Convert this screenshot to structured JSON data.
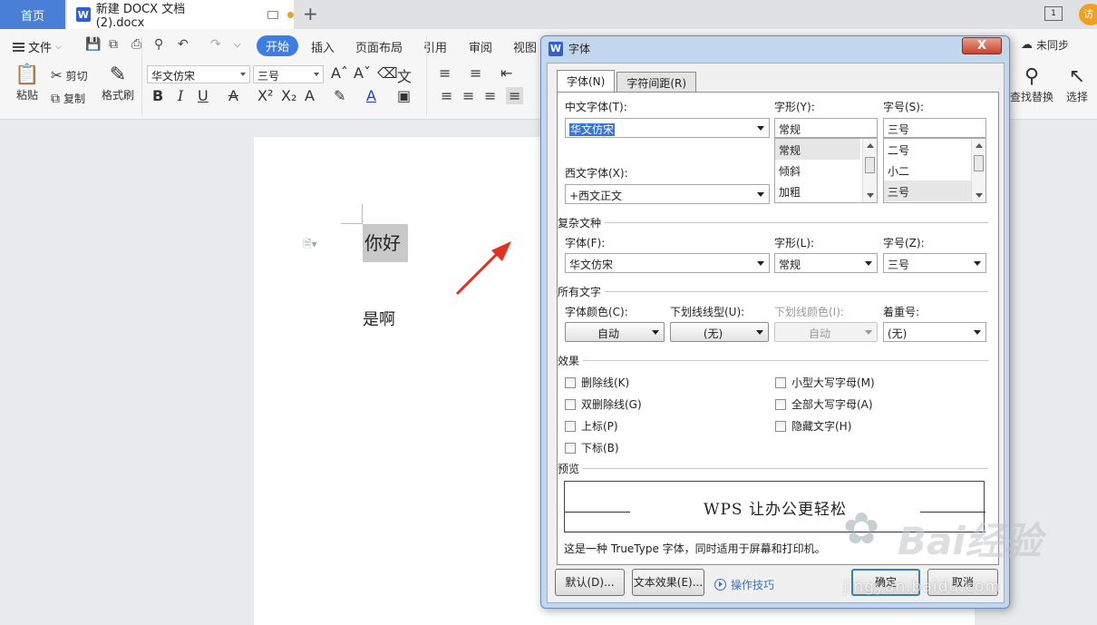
{
  "tabbar": {
    "home": "首页",
    "doc_title": "新建 DOCX 文档 (2).docx",
    "add": "+",
    "right_badge": "1",
    "visit": "访"
  },
  "ribbon": {
    "file": "文件",
    "tabs": [
      "开始",
      "插入",
      "页面布局",
      "引用",
      "审阅",
      "视图"
    ],
    "paste": "粘贴",
    "cut": "剪切",
    "copy": "复制",
    "format_painter": "格式刷",
    "font_name": "华文仿宋",
    "font_size": "三号",
    "unsync": "未同步",
    "find_replace": "查找替换",
    "select": "选择"
  },
  "document": {
    "selected_text": "你好",
    "body_text": "是啊"
  },
  "dialog": {
    "title": "字体",
    "close": "X",
    "tabs": [
      "字体(N)",
      "字符间距(R)"
    ],
    "cn_font_label": "中文字体(T):",
    "cn_font_value": "华文仿宋",
    "style_label": "字形(Y):",
    "style_value": "常规",
    "style_list": [
      "常规",
      "倾斜",
      "加粗"
    ],
    "size_label": "字号(S):",
    "size_value": "三号",
    "size_list": [
      "二号",
      "小二",
      "三号"
    ],
    "west_font_label": "西文字体(X):",
    "west_font_value": "+西文正文",
    "complex_section": "复杂文种",
    "complex_font_label": "字体(F):",
    "complex_font_value": "华文仿宋",
    "complex_style_label": "字形(L):",
    "complex_style_value": "常规",
    "complex_size_label": "字号(Z):",
    "complex_size_value": "三号",
    "all_text_section": "所有文字",
    "color_label": "字体颜色(C):",
    "color_value": "自动",
    "underline_label": "下划线线型(U):",
    "underline_value": "(无)",
    "underline_color_label": "下划线颜色(I):",
    "underline_color_value": "自动",
    "emphasis_label": "着重号:",
    "emphasis_value": "(无)",
    "effects_section": "效果",
    "effects_left": [
      "删除线(K)",
      "双删除线(G)",
      "上标(P)",
      "下标(B)"
    ],
    "effects_right": [
      "小型大写字母(M)",
      "全部大写字母(A)",
      "隐藏文字(H)"
    ],
    "preview_section": "预览",
    "preview_text": "WPS 让办公更轻松",
    "note": "这是一种 TrueType 字体，同时适用于屏幕和打印机。",
    "default_btn": "默认(D)...",
    "text_effect_btn": "文本效果(E)...",
    "tips": "操作技巧",
    "ok_btn": "确定",
    "cancel_btn": "取消"
  },
  "watermark": {
    "brand": "Bai经验",
    "url": "jingyan.baidu.com"
  }
}
